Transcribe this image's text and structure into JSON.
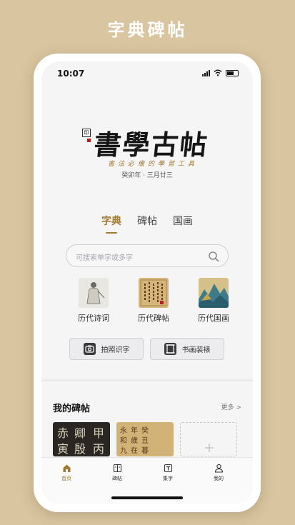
{
  "promo": {
    "title": "字典碑帖"
  },
  "status": {
    "time": "10:07"
  },
  "header": {
    "logo_text": "書學古帖",
    "seal_text": "印",
    "slogan": "書法必備的學習工具",
    "date": "癸卯年 · 三月廿三"
  },
  "tabs": [
    {
      "label": "字典",
      "active": true
    },
    {
      "label": "碑帖",
      "active": false
    },
    {
      "label": "国画",
      "active": false
    }
  ],
  "search": {
    "placeholder": "可搜索单字或多字"
  },
  "categories": [
    {
      "label": "历代诗词",
      "icon": "poetry-figure-icon"
    },
    {
      "label": "历代碑帖",
      "icon": "stele-calligraphy-icon"
    },
    {
      "label": "历代国画",
      "icon": "landscape-painting-icon"
    }
  ],
  "actions": [
    {
      "label": "拍照识字",
      "icon": "camera-icon"
    },
    {
      "label": "书画装裱",
      "icon": "frame-icon"
    }
  ],
  "my_section": {
    "title": "我的碑帖",
    "more": "更多 >"
  },
  "thumb_chars": {
    "dark": [
      "赤",
      "卿",
      "甲",
      "寅",
      "殷",
      "丙"
    ],
    "light": [
      "永",
      "和",
      "九",
      "年",
      "歲",
      "在",
      "癸",
      "丑",
      "暮"
    ]
  },
  "tabbar": [
    {
      "label": "首页",
      "icon": "home-icon",
      "active": true
    },
    {
      "label": "碑帖",
      "icon": "book-icon",
      "active": false
    },
    {
      "label": "集字",
      "icon": "text-icon",
      "active": false
    },
    {
      "label": "我的",
      "icon": "user-icon",
      "active": false
    }
  ],
  "colors": {
    "accent": "#a3792e",
    "background": "#d9c5a0"
  }
}
